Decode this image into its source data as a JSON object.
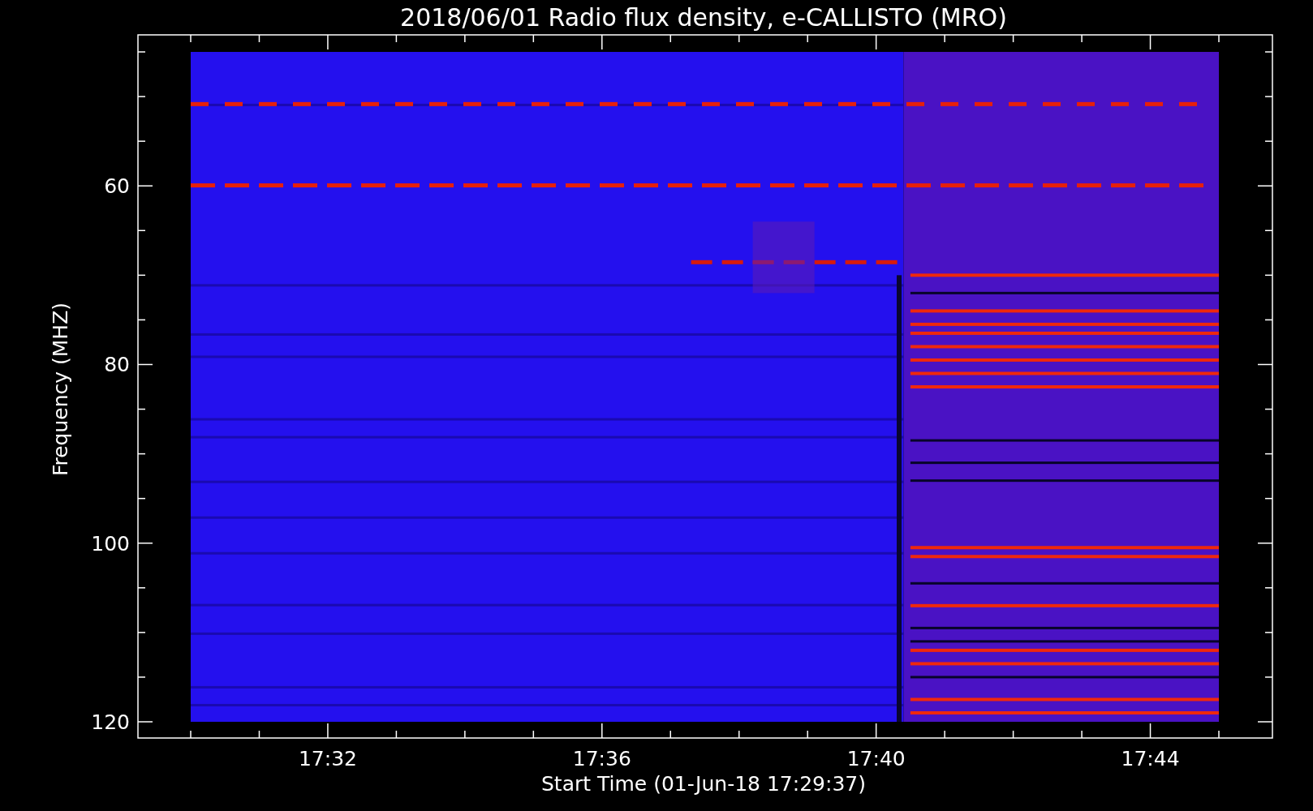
{
  "title": "2018/06/01  Radio flux density, e-CALLISTO (MRO)",
  "y_axis": {
    "label": "Frequency (MHZ)",
    "ticks": [
      "60",
      "80",
      "100",
      "120"
    ]
  },
  "x_axis": {
    "label": "Start Time (01-Jun-18 17:29:37)",
    "ticks": [
      "17:32",
      "17:36",
      "17:40",
      "17:44"
    ]
  }
}
